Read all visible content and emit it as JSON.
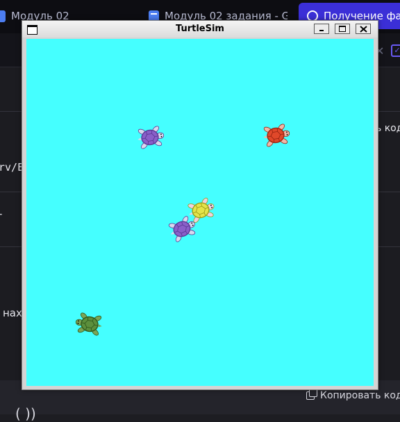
{
  "browser": {
    "tabs": [
      {
        "label": "Модуль 02"
      },
      {
        "label": "Модуль 02 задания - G"
      },
      {
        "label": "Получение фа"
      }
    ]
  },
  "page": {
    "right_partial_text": "ь код",
    "left_partial_mono": "rv/E",
    "left_partial_text2": "-",
    "left_partial_text3": "нах",
    "copy_label": "Копировать код",
    "footer_partial": "( ))"
  },
  "turtlesim": {
    "title": "TurtleSim",
    "background_color": "#45ffff",
    "turtles": [
      {
        "name": "turtle-purple-1",
        "shell": "#8a5fc9",
        "rim": "#5b3a96",
        "skin": "#d9d9ee"
      },
      {
        "name": "turtle-red",
        "shell": "#e0482a",
        "rim": "#9a2511",
        "skin": "#f2b8a8"
      },
      {
        "name": "turtle-yellow",
        "shell": "#e3e44a",
        "rim": "#9c9c1a",
        "skin": "#f0d0e0"
      },
      {
        "name": "turtle-purple-2",
        "shell": "#8a5fc9",
        "rim": "#5b3a96",
        "skin": "#d9d9ee"
      },
      {
        "name": "turtle-green",
        "shell": "#5c8f3c",
        "rim": "#2f5a1d",
        "skin": "#7ba556"
      }
    ]
  }
}
